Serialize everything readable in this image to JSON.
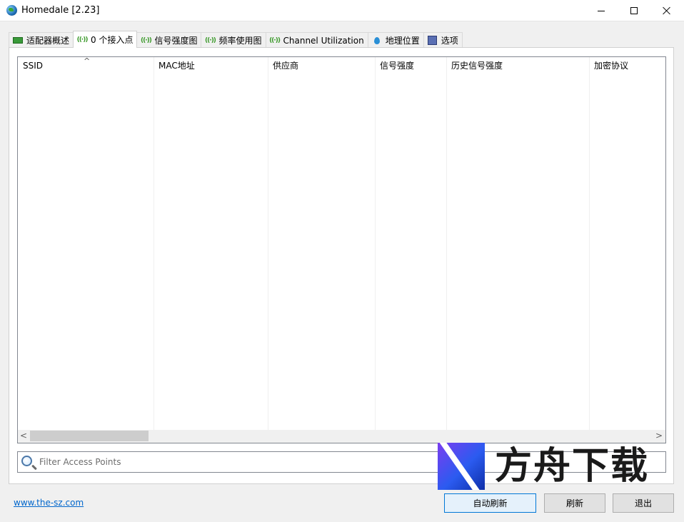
{
  "window": {
    "title": "Homedale [2.23]",
    "app_icon": "globe-icon",
    "controls": {
      "minimize": "minimize-icon",
      "maximize": "maximize-icon",
      "close": "close-icon"
    }
  },
  "tabs": [
    {
      "label": "适配器概述",
      "icon": "network-adapter-icon",
      "active": false
    },
    {
      "label": "0 个接入点",
      "icon": "antenna-icon",
      "active": true
    },
    {
      "label": "信号强度图",
      "icon": "antenna-icon",
      "active": false
    },
    {
      "label": "频率使用图",
      "icon": "antenna-icon",
      "active": false
    },
    {
      "label": "Channel Utilization",
      "icon": "antenna-icon",
      "active": false
    },
    {
      "label": "地理位置",
      "icon": "location-pin-icon",
      "active": false
    },
    {
      "label": "选项",
      "icon": "options-icon",
      "active": false
    }
  ],
  "table": {
    "columns": [
      "SSID",
      "MAC地址",
      "供应商",
      "信号强度",
      "历史信号强度",
      "加密协议"
    ],
    "sort_indicator": "^",
    "rows": []
  },
  "scrollbar": {
    "left_arrow": "<",
    "right_arrow": ">"
  },
  "filter": {
    "placeholder": "Filter Access Points",
    "value": ""
  },
  "footer": {
    "link": "www.the-sz.com",
    "buttons": {
      "auto_refresh": "自动刷新",
      "refresh": "刷新",
      "exit": "退出"
    }
  },
  "watermark": {
    "text": "方舟下载"
  },
  "colors": {
    "link": "#0066cc",
    "primary_button_border": "#0078d7",
    "primary_button_bg": "#e5f1fb",
    "antenna_green": "#3c9a2b"
  }
}
